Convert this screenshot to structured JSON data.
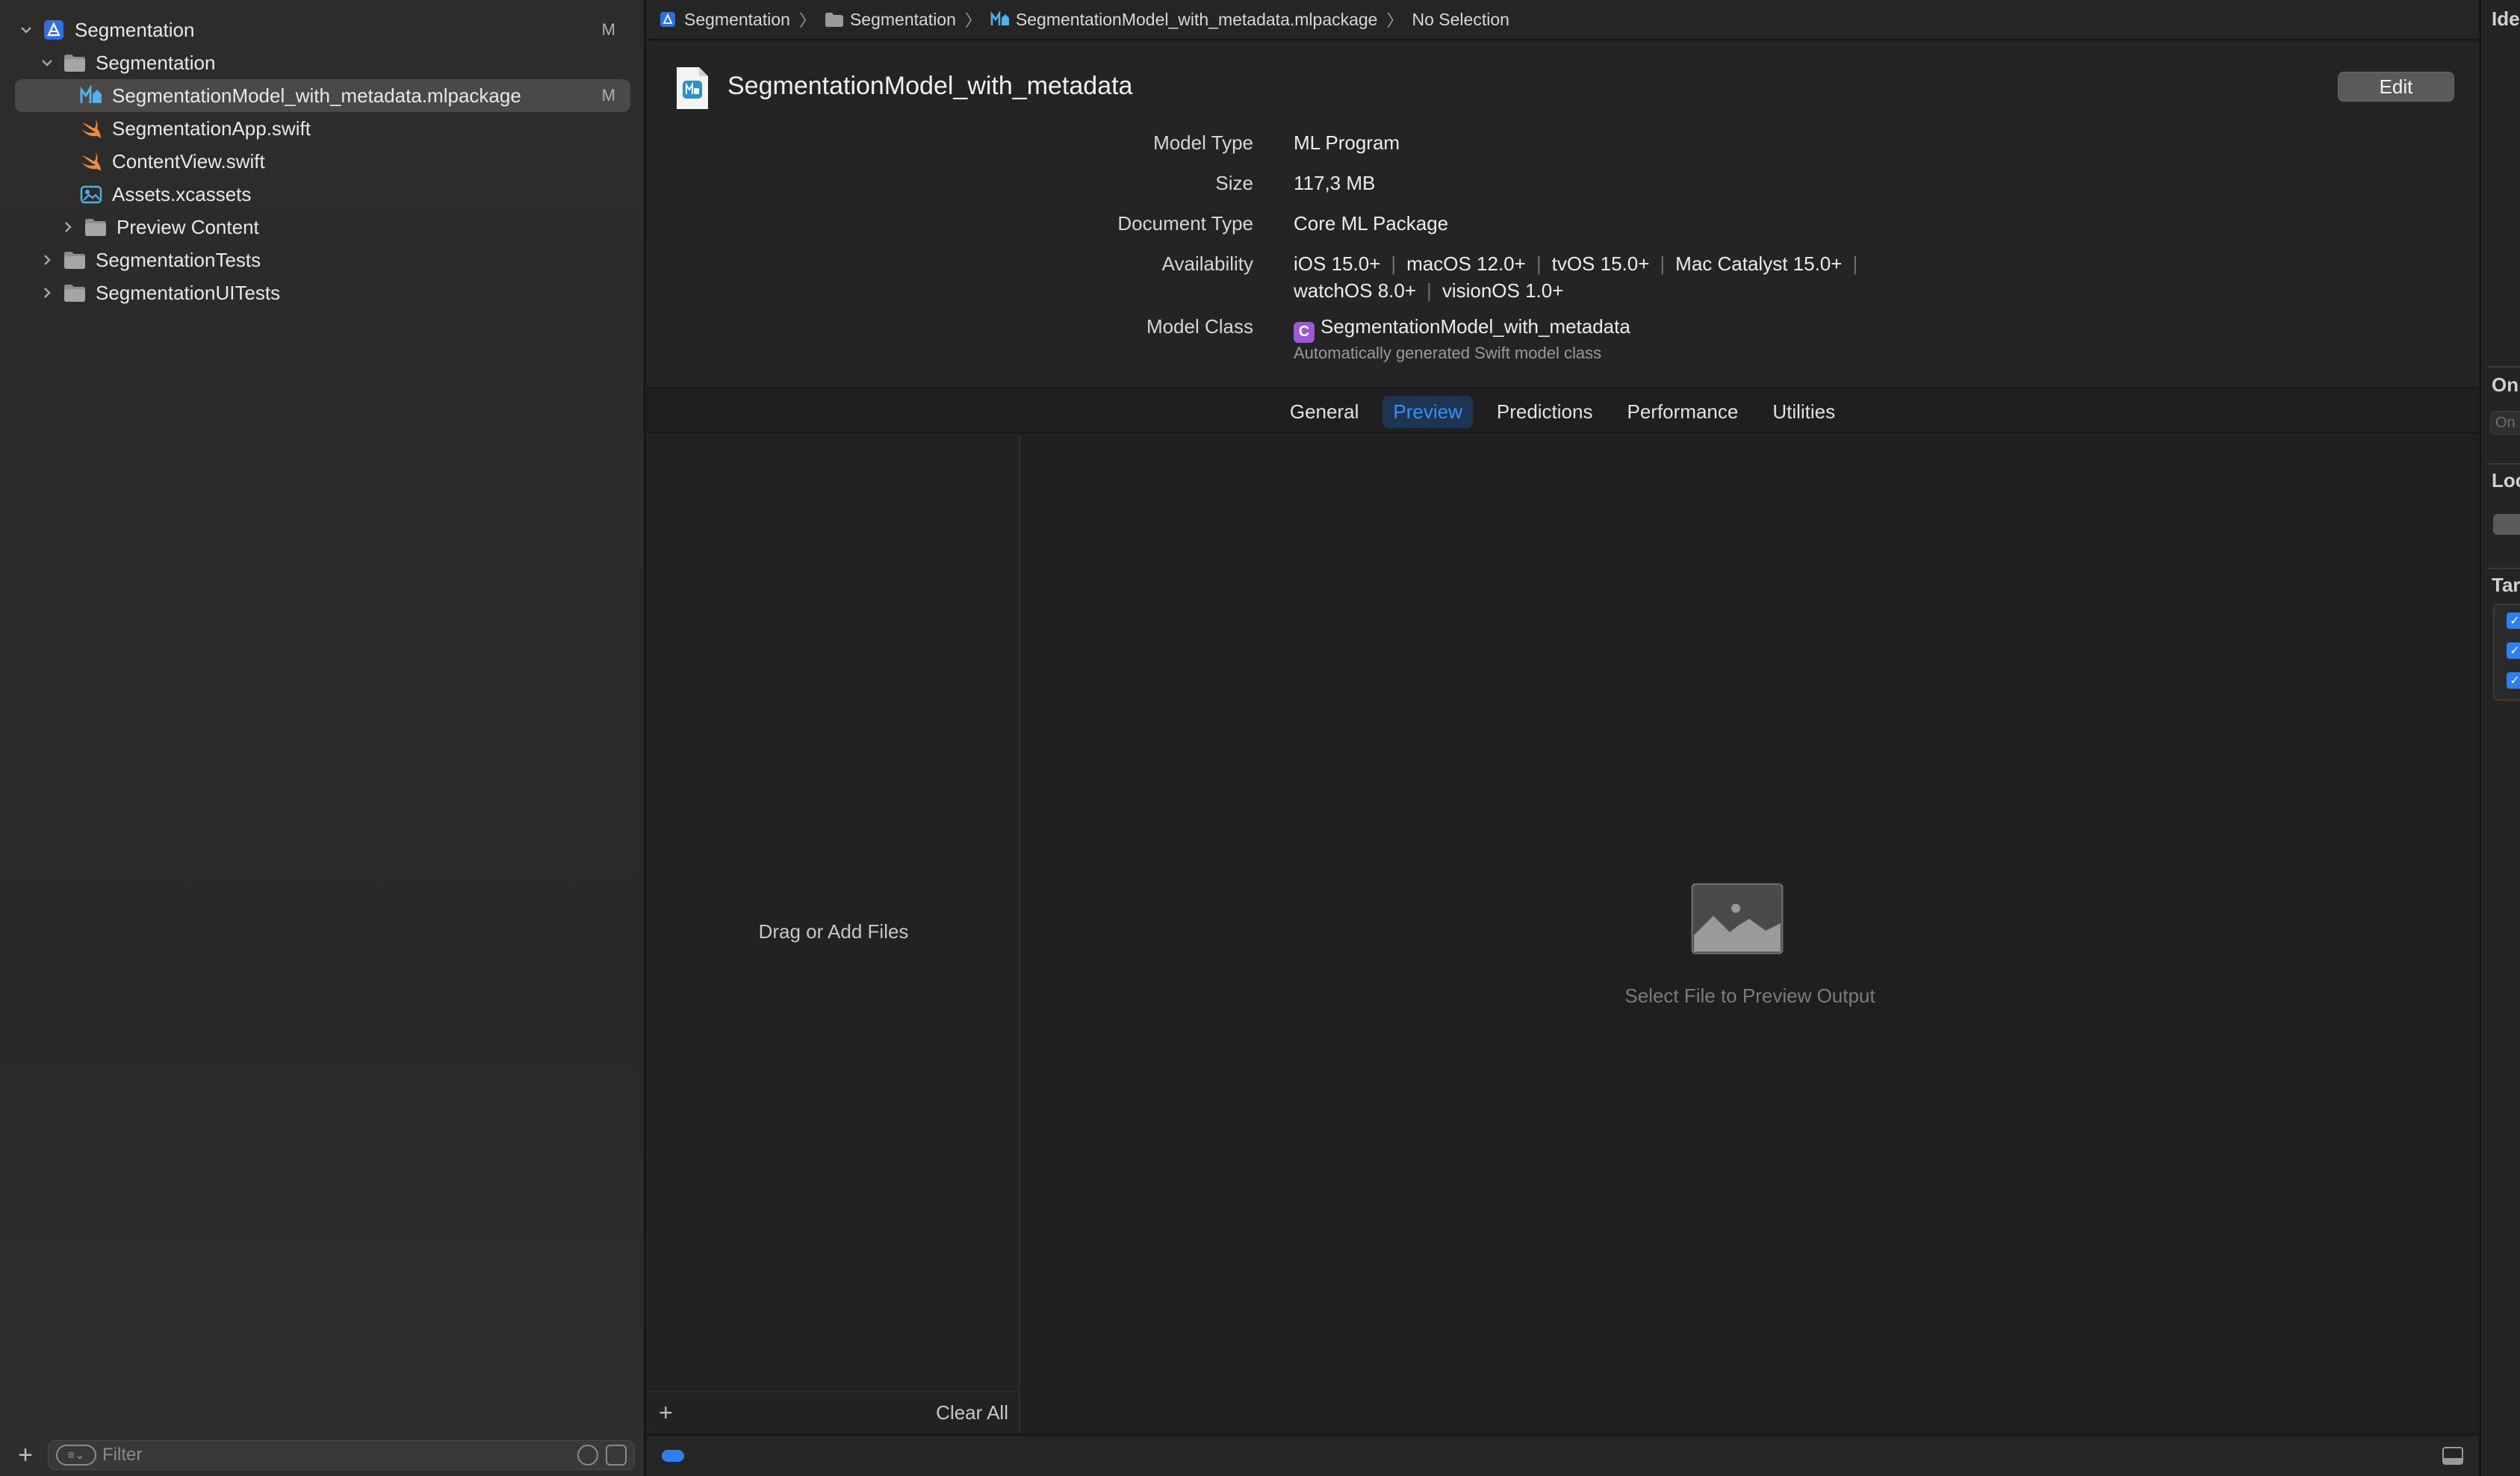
{
  "navigator": {
    "items": [
      {
        "label": "Segmentation",
        "badge": "M",
        "icon": "xcode-project-icon"
      },
      {
        "label": "Segmentation",
        "badge": "",
        "icon": "folder-icon"
      },
      {
        "label": "SegmentationModel_with_metadata.mlpackage",
        "badge": "M",
        "icon": "mlmodel-icon"
      },
      {
        "label": "SegmentationApp.swift",
        "badge": "",
        "icon": "swift-icon"
      },
      {
        "label": "ContentView.swift",
        "badge": "",
        "icon": "swift-icon"
      },
      {
        "label": "Assets.xcassets",
        "badge": "",
        "icon": "assets-icon"
      },
      {
        "label": "Preview Content",
        "badge": "",
        "icon": "folder-icon"
      },
      {
        "label": "SegmentationTests",
        "badge": "",
        "icon": "folder-icon"
      },
      {
        "label": "SegmentationUITests",
        "badge": "",
        "icon": "folder-icon"
      }
    ],
    "filter_placeholder": "Filter"
  },
  "jumpbar": {
    "crumbs": [
      "Segmentation",
      "Segmentation",
      "SegmentationModel_with_metadata.mlpackage",
      "No Selection"
    ]
  },
  "model": {
    "title": "SegmentationModel_with_metadata",
    "edit_label": "Edit",
    "rows": [
      {
        "key": "Model Type",
        "value": "ML Program"
      },
      {
        "key": "Size",
        "value": "117,3 MB"
      },
      {
        "key": "Document Type",
        "value": "Core ML Package"
      },
      {
        "key": "Availability",
        "value": ""
      },
      {
        "key": "Model Class",
        "value": "SegmentationModel_with_metadata"
      }
    ],
    "availability_line1": [
      "iOS 15.0+",
      "macOS 12.0+",
      "tvOS 15.0+",
      "Mac Catalyst 15.0+"
    ],
    "availability_line2": [
      "watchOS 8.0+",
      "visionOS 1.0+"
    ],
    "class_chip": "C",
    "class_note": "Automatically generated Swift model class"
  },
  "tabs": [
    "General",
    "Preview",
    "Predictions",
    "Performance",
    "Utilities"
  ],
  "active_tab": "Preview",
  "preview": {
    "drag_text": "Drag or Add Files",
    "clear_label": "Clear All",
    "placeholder_text": "Select File to Preview Output"
  },
  "inspector": {
    "labels": [
      "Ide",
      "On",
      "Loc",
      "Tar"
    ],
    "field_placeholder": "On"
  },
  "colors": {
    "accent": "#2f80ed",
    "class_chip": "#9b59d6",
    "swift": "#f0883e"
  }
}
